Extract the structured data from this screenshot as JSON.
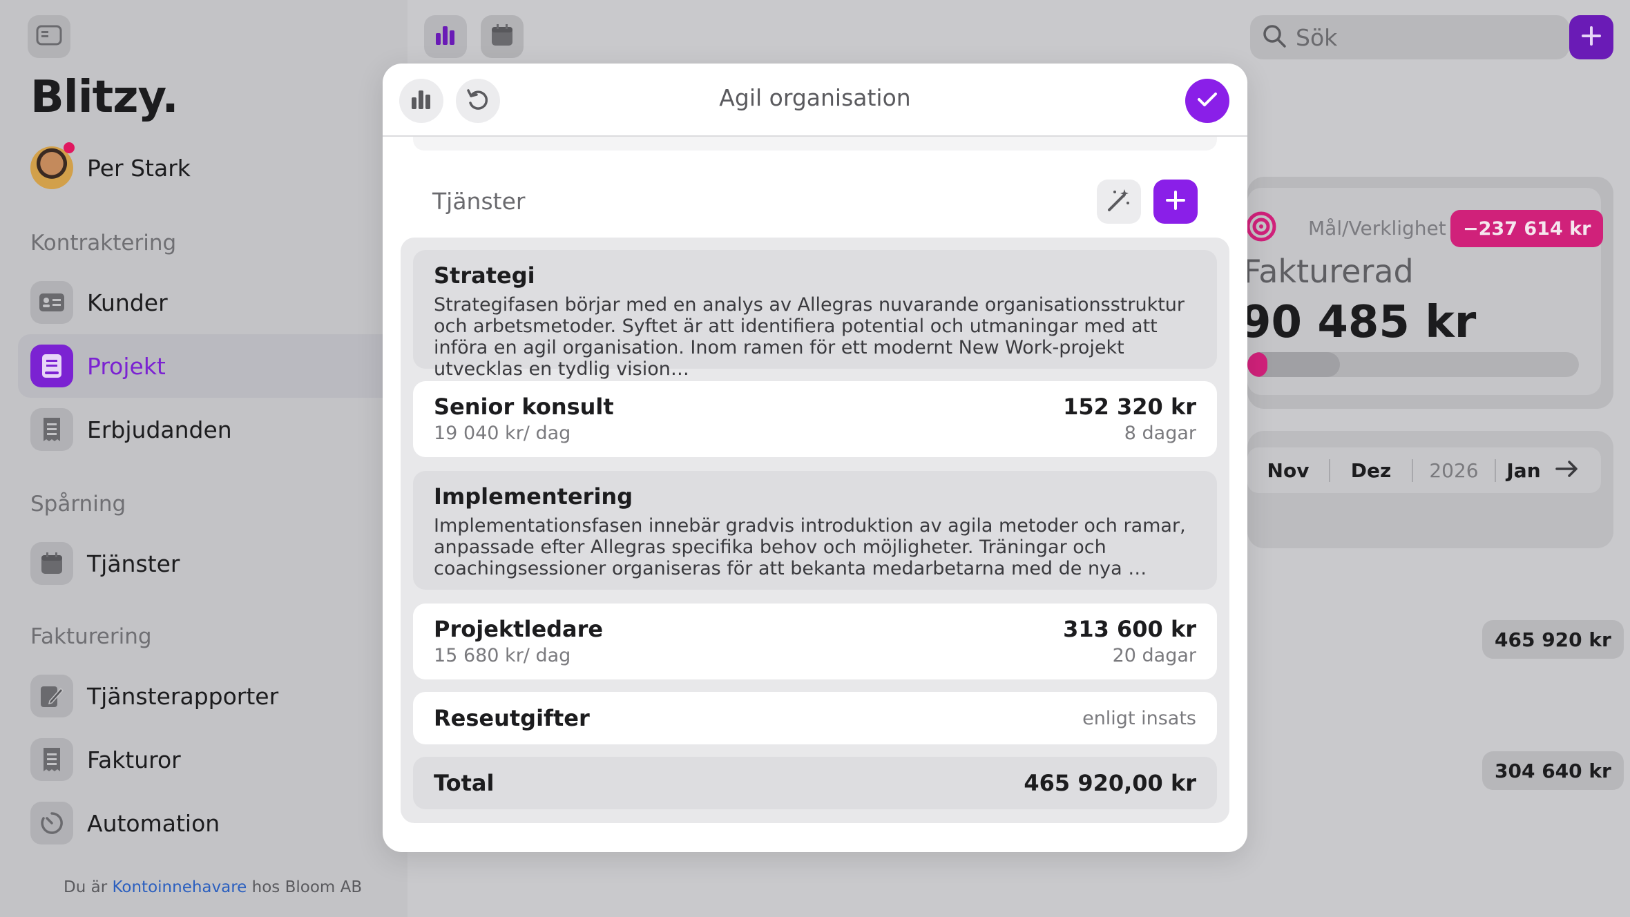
{
  "app": {
    "logo": "Blitzy."
  },
  "user": {
    "name": "Per Stark"
  },
  "sidebar": {
    "sections": [
      {
        "title": "Kontraktering",
        "items": [
          {
            "label": "Kunder"
          },
          {
            "label": "Projekt"
          },
          {
            "label": "Erbjudanden"
          }
        ]
      },
      {
        "title": "Spårning",
        "items": [
          {
            "label": "Tjänster"
          }
        ]
      },
      {
        "title": "Fakturering",
        "items": [
          {
            "label": "Tjänsterapporter"
          },
          {
            "label": "Fakturor"
          },
          {
            "label": "Automation"
          }
        ]
      }
    ],
    "active_item": "Projekt",
    "footer": {
      "prefix": "Du är",
      "link": "Kontoinnehavare",
      "suffix": "hos Bloom AB"
    }
  },
  "topbar": {
    "search_placeholder": "Sök"
  },
  "background_stats": {
    "goal_label": "Mål/Verklighet",
    "goal_diff": "−237 614 kr",
    "invoiced_label": "Fakturerad",
    "invoiced_value": "90 485 kr",
    "progress_fraction": 0.06,
    "progress_secondary_fraction": 0.28,
    "months": [
      "Nov",
      "Dez",
      "2026",
      "Jan"
    ],
    "amounts": [
      "465 920 kr",
      "304 640 kr"
    ]
  },
  "modal": {
    "title": "Agil organisation",
    "section_label": "Tjänster",
    "items": [
      {
        "type": "phase",
        "title": "Strategi",
        "description": "Strategifasen börjar med en analys av Allegras nuvarande organisationsstruktur och arbetsmetoder. Syftet är att identifiera potential och utmaningar med att införa en agil organisation. Inom ramen för ett modernt New Work-projekt utvecklas en tydlig vision…"
      },
      {
        "type": "service",
        "title": "Senior konsult",
        "rate": "19 040 kr/ dag",
        "amount": "152 320 kr",
        "quantity": "8 dagar"
      },
      {
        "type": "phase",
        "title": "Implementering",
        "description": "Implementationsfasen innebär gradvis introduktion av agila metoder och ramar, anpassade efter Allegras specifika behov och möjligheter. Träningar och coachingsessioner organiseras för att bekanta medarbetarna med de nya …"
      },
      {
        "type": "service",
        "title": "Projektledare",
        "rate": "15 680 kr/ dag",
        "amount": "313 600 kr",
        "quantity": "20 dagar"
      },
      {
        "type": "expense",
        "title": "Reseutgifter",
        "note": "enligt insats"
      }
    ],
    "total": {
      "label": "Total",
      "value": "465 920,00 kr"
    }
  },
  "colors": {
    "accent": "#8a1fe8",
    "accent_dim": "#7b22d2",
    "danger": "#d0217a",
    "link": "#2b5fbf"
  }
}
